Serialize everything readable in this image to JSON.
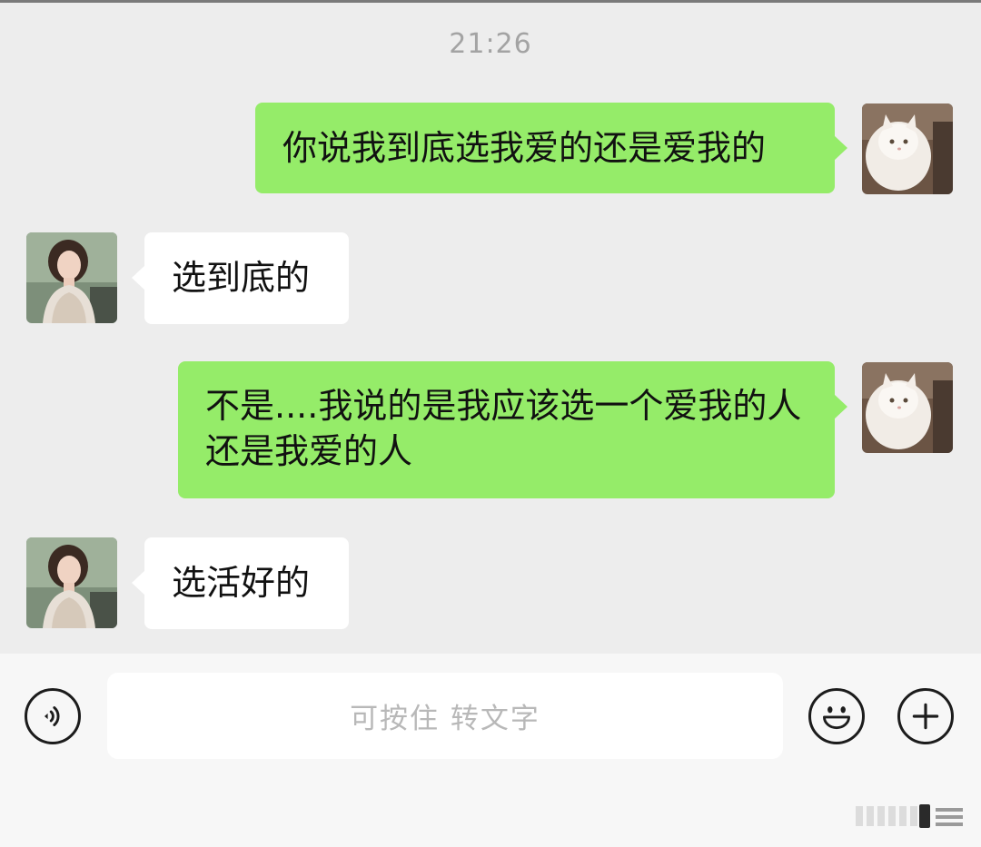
{
  "chat": {
    "timestamp": "21:26",
    "messages": [
      {
        "from": "me",
        "text": "你说我到底选我爱的还是爱我的"
      },
      {
        "from": "friend",
        "text": "选到底的"
      },
      {
        "from": "me",
        "text": "不是....我说的是我应该选一个爱我的人还是我爱的人"
      },
      {
        "from": "friend",
        "text": "选活好的"
      }
    ]
  },
  "input_bar": {
    "placeholder": "可按住 转文字",
    "voice_icon": "voice-icon",
    "emoji_icon": "emoji-icon",
    "more_icon": "plus-icon"
  },
  "colors": {
    "outgoing_bubble": "#95ec69",
    "incoming_bubble": "#ffffff",
    "chat_background": "#ededed",
    "input_bar_background": "#f7f7f7"
  }
}
